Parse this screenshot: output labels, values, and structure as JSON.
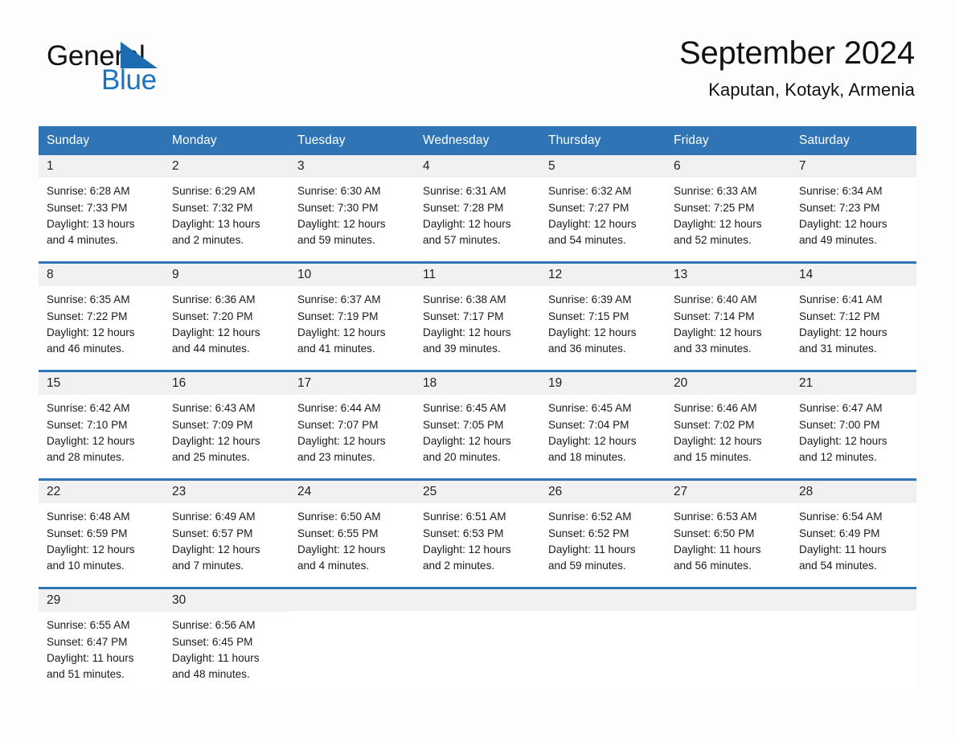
{
  "brand": {
    "name_part1": "General",
    "name_part2": "Blue",
    "triangle_color": "#1b6cb0",
    "blue_text_color": "#1b74bd"
  },
  "header": {
    "month_year": "September 2024",
    "location": "Kaputan, Kotayk, Armenia"
  },
  "calendar": {
    "header_bg": "#2f74b5",
    "header_text_color": "#ffffff",
    "day_band_bg": "#f1f1f1",
    "weekdays": [
      "Sunday",
      "Monday",
      "Tuesday",
      "Wednesday",
      "Thursday",
      "Friday",
      "Saturday"
    ],
    "weeks": [
      [
        {
          "day": "1",
          "sunrise": "Sunrise: 6:28 AM",
          "sunset": "Sunset: 7:33 PM",
          "daylight_line1": "Daylight: 13 hours",
          "daylight_line2": "and 4 minutes."
        },
        {
          "day": "2",
          "sunrise": "Sunrise: 6:29 AM",
          "sunset": "Sunset: 7:32 PM",
          "daylight_line1": "Daylight: 13 hours",
          "daylight_line2": "and 2 minutes."
        },
        {
          "day": "3",
          "sunrise": "Sunrise: 6:30 AM",
          "sunset": "Sunset: 7:30 PM",
          "daylight_line1": "Daylight: 12 hours",
          "daylight_line2": "and 59 minutes."
        },
        {
          "day": "4",
          "sunrise": "Sunrise: 6:31 AM",
          "sunset": "Sunset: 7:28 PM",
          "daylight_line1": "Daylight: 12 hours",
          "daylight_line2": "and 57 minutes."
        },
        {
          "day": "5",
          "sunrise": "Sunrise: 6:32 AM",
          "sunset": "Sunset: 7:27 PM",
          "daylight_line1": "Daylight: 12 hours",
          "daylight_line2": "and 54 minutes."
        },
        {
          "day": "6",
          "sunrise": "Sunrise: 6:33 AM",
          "sunset": "Sunset: 7:25 PM",
          "daylight_line1": "Daylight: 12 hours",
          "daylight_line2": "and 52 minutes."
        },
        {
          "day": "7",
          "sunrise": "Sunrise: 6:34 AM",
          "sunset": "Sunset: 7:23 PM",
          "daylight_line1": "Daylight: 12 hours",
          "daylight_line2": "and 49 minutes."
        }
      ],
      [
        {
          "day": "8",
          "sunrise": "Sunrise: 6:35 AM",
          "sunset": "Sunset: 7:22 PM",
          "daylight_line1": "Daylight: 12 hours",
          "daylight_line2": "and 46 minutes."
        },
        {
          "day": "9",
          "sunrise": "Sunrise: 6:36 AM",
          "sunset": "Sunset: 7:20 PM",
          "daylight_line1": "Daylight: 12 hours",
          "daylight_line2": "and 44 minutes."
        },
        {
          "day": "10",
          "sunrise": "Sunrise: 6:37 AM",
          "sunset": "Sunset: 7:19 PM",
          "daylight_line1": "Daylight: 12 hours",
          "daylight_line2": "and 41 minutes."
        },
        {
          "day": "11",
          "sunrise": "Sunrise: 6:38 AM",
          "sunset": "Sunset: 7:17 PM",
          "daylight_line1": "Daylight: 12 hours",
          "daylight_line2": "and 39 minutes."
        },
        {
          "day": "12",
          "sunrise": "Sunrise: 6:39 AM",
          "sunset": "Sunset: 7:15 PM",
          "daylight_line1": "Daylight: 12 hours",
          "daylight_line2": "and 36 minutes."
        },
        {
          "day": "13",
          "sunrise": "Sunrise: 6:40 AM",
          "sunset": "Sunset: 7:14 PM",
          "daylight_line1": "Daylight: 12 hours",
          "daylight_line2": "and 33 minutes."
        },
        {
          "day": "14",
          "sunrise": "Sunrise: 6:41 AM",
          "sunset": "Sunset: 7:12 PM",
          "daylight_line1": "Daylight: 12 hours",
          "daylight_line2": "and 31 minutes."
        }
      ],
      [
        {
          "day": "15",
          "sunrise": "Sunrise: 6:42 AM",
          "sunset": "Sunset: 7:10 PM",
          "daylight_line1": "Daylight: 12 hours",
          "daylight_line2": "and 28 minutes."
        },
        {
          "day": "16",
          "sunrise": "Sunrise: 6:43 AM",
          "sunset": "Sunset: 7:09 PM",
          "daylight_line1": "Daylight: 12 hours",
          "daylight_line2": "and 25 minutes."
        },
        {
          "day": "17",
          "sunrise": "Sunrise: 6:44 AM",
          "sunset": "Sunset: 7:07 PM",
          "daylight_line1": "Daylight: 12 hours",
          "daylight_line2": "and 23 minutes."
        },
        {
          "day": "18",
          "sunrise": "Sunrise: 6:45 AM",
          "sunset": "Sunset: 7:05 PM",
          "daylight_line1": "Daylight: 12 hours",
          "daylight_line2": "and 20 minutes."
        },
        {
          "day": "19",
          "sunrise": "Sunrise: 6:45 AM",
          "sunset": "Sunset: 7:04 PM",
          "daylight_line1": "Daylight: 12 hours",
          "daylight_line2": "and 18 minutes."
        },
        {
          "day": "20",
          "sunrise": "Sunrise: 6:46 AM",
          "sunset": "Sunset: 7:02 PM",
          "daylight_line1": "Daylight: 12 hours",
          "daylight_line2": "and 15 minutes."
        },
        {
          "day": "21",
          "sunrise": "Sunrise: 6:47 AM",
          "sunset": "Sunset: 7:00 PM",
          "daylight_line1": "Daylight: 12 hours",
          "daylight_line2": "and 12 minutes."
        }
      ],
      [
        {
          "day": "22",
          "sunrise": "Sunrise: 6:48 AM",
          "sunset": "Sunset: 6:59 PM",
          "daylight_line1": "Daylight: 12 hours",
          "daylight_line2": "and 10 minutes."
        },
        {
          "day": "23",
          "sunrise": "Sunrise: 6:49 AM",
          "sunset": "Sunset: 6:57 PM",
          "daylight_line1": "Daylight: 12 hours",
          "daylight_line2": "and 7 minutes."
        },
        {
          "day": "24",
          "sunrise": "Sunrise: 6:50 AM",
          "sunset": "Sunset: 6:55 PM",
          "daylight_line1": "Daylight: 12 hours",
          "daylight_line2": "and 4 minutes."
        },
        {
          "day": "25",
          "sunrise": "Sunrise: 6:51 AM",
          "sunset": "Sunset: 6:53 PM",
          "daylight_line1": "Daylight: 12 hours",
          "daylight_line2": "and 2 minutes."
        },
        {
          "day": "26",
          "sunrise": "Sunrise: 6:52 AM",
          "sunset": "Sunset: 6:52 PM",
          "daylight_line1": "Daylight: 11 hours",
          "daylight_line2": "and 59 minutes."
        },
        {
          "day": "27",
          "sunrise": "Sunrise: 6:53 AM",
          "sunset": "Sunset: 6:50 PM",
          "daylight_line1": "Daylight: 11 hours",
          "daylight_line2": "and 56 minutes."
        },
        {
          "day": "28",
          "sunrise": "Sunrise: 6:54 AM",
          "sunset": "Sunset: 6:49 PM",
          "daylight_line1": "Daylight: 11 hours",
          "daylight_line2": "and 54 minutes."
        }
      ],
      [
        {
          "day": "29",
          "sunrise": "Sunrise: 6:55 AM",
          "sunset": "Sunset: 6:47 PM",
          "daylight_line1": "Daylight: 11 hours",
          "daylight_line2": "and 51 minutes."
        },
        {
          "day": "30",
          "sunrise": "Sunrise: 6:56 AM",
          "sunset": "Sunset: 6:45 PM",
          "daylight_line1": "Daylight: 11 hours",
          "daylight_line2": "and 48 minutes."
        },
        {
          "day": "",
          "sunrise": "",
          "sunset": "",
          "daylight_line1": "",
          "daylight_line2": ""
        },
        {
          "day": "",
          "sunrise": "",
          "sunset": "",
          "daylight_line1": "",
          "daylight_line2": ""
        },
        {
          "day": "",
          "sunrise": "",
          "sunset": "",
          "daylight_line1": "",
          "daylight_line2": ""
        },
        {
          "day": "",
          "sunrise": "",
          "sunset": "",
          "daylight_line1": "",
          "daylight_line2": ""
        },
        {
          "day": "",
          "sunrise": "",
          "sunset": "",
          "daylight_line1": "",
          "daylight_line2": ""
        }
      ]
    ]
  }
}
